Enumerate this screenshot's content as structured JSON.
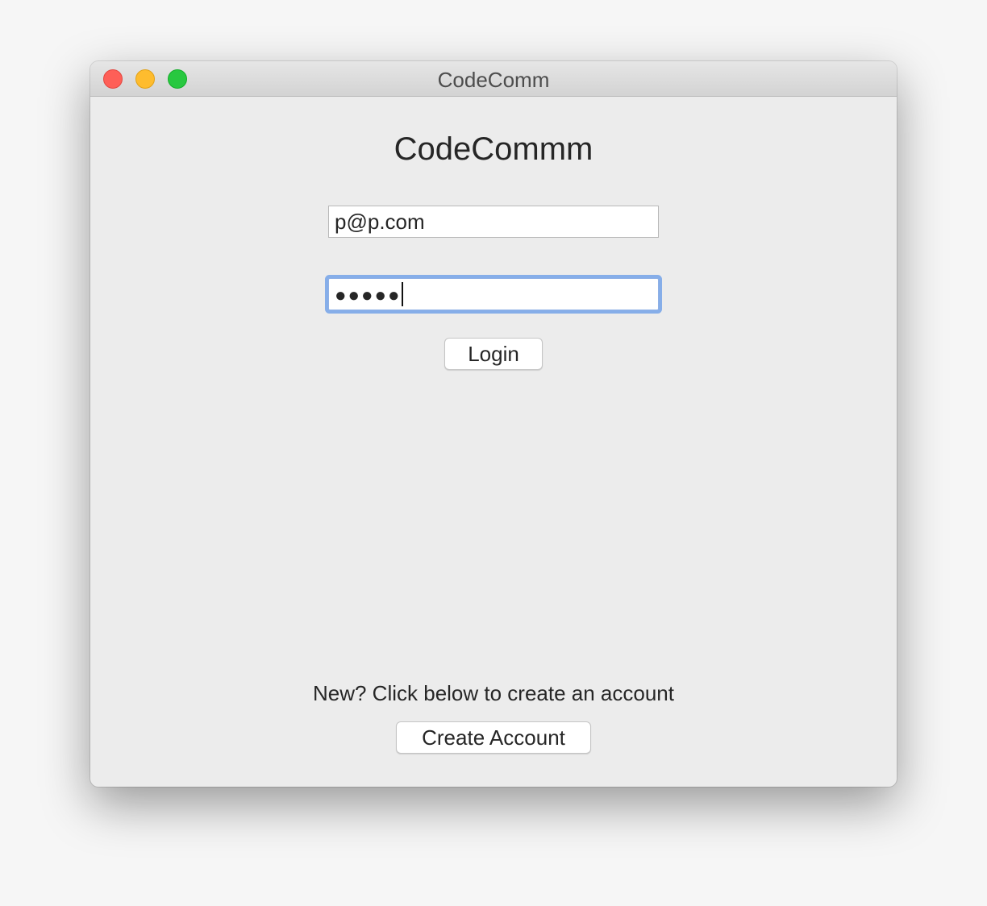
{
  "window": {
    "title": "CodeComm"
  },
  "login_form": {
    "heading": "CodeCommm",
    "email_value": "p@p.com",
    "password_masked": "●●●●●",
    "login_label": "Login"
  },
  "signup": {
    "hint": "New? Click below to create an account",
    "create_label": "Create Account"
  },
  "colors": {
    "focus_ring": "#86aee9",
    "close": "#fe5f57",
    "minimize": "#febc2e",
    "maximize": "#28c840"
  },
  "icons": [
    "close-icon",
    "minimize-icon",
    "maximize-icon"
  ]
}
